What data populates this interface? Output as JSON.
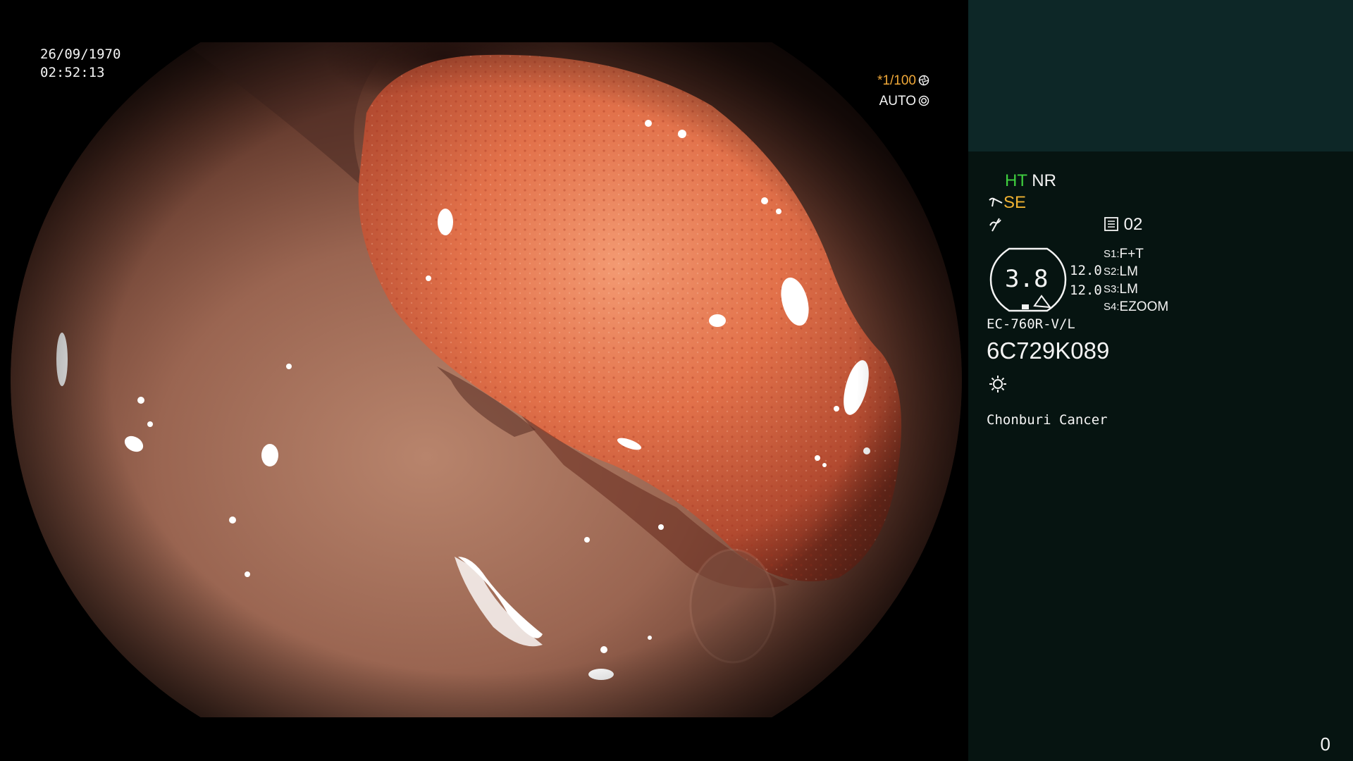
{
  "overlay": {
    "date": "26/09/1970",
    "time": "02:52:13",
    "exposure": "*1/100",
    "mode": "AUTO"
  },
  "panel": {
    "ht": "HT",
    "nr": "NR",
    "se": "SE",
    "preset_number": "02",
    "dial_value": "3.8",
    "value_1": "12.0",
    "value_2": "12.0",
    "scope_settings": [
      {
        "label": "S1:",
        "value": "F+T"
      },
      {
        "label": "S2:",
        "value": "LM"
      },
      {
        "label": "S3:",
        "value": "LM"
      },
      {
        "label": "S4:",
        "value": "EZOOM"
      }
    ],
    "scope_model": "EC-760R-V/L",
    "serial": "6C729K089",
    "institution": "Chonburi Cancer",
    "counter": "0"
  },
  "colors": {
    "panel_bg": "#061411",
    "panel_top_bg": "#0d2727",
    "ht_green": "#3fcf3f",
    "se_orange": "#f0b232",
    "exposure_orange": "#f0a838"
  },
  "icons": [
    "shutter-icon",
    "gear-icon",
    "scope-tip-icon",
    "enhance-icon",
    "memory-icon",
    "lamp-icon"
  ]
}
